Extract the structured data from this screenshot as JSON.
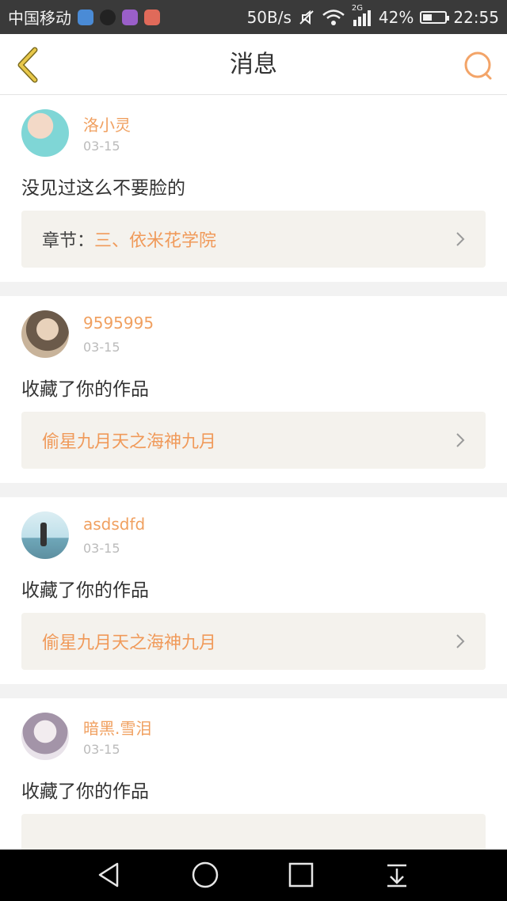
{
  "status_bar": {
    "carrier": "中国移动",
    "speed": "50B/s",
    "network": "2G",
    "battery": "42%",
    "battery_level": 0.42,
    "time": "22:55"
  },
  "header": {
    "title": "消息"
  },
  "messages": [
    {
      "username": "洛小灵",
      "date": "03-15",
      "text": "没见过这么不要脸的",
      "ref_prefix": "章节：",
      "ref_title": "三、依米花学院",
      "avatar_colors": [
        "#7fd6d6",
        "#f3d9c7"
      ]
    },
    {
      "username": "9595995",
      "date": "03-15",
      "text": "收藏了你的作品",
      "ref_prefix": "",
      "ref_title": "偷星九月天之海神九月",
      "avatar_colors": [
        "#c8b39a",
        "#6b5a4a"
      ]
    },
    {
      "username": "asdsdfd",
      "date": "03-15",
      "text": "收藏了你的作品",
      "ref_prefix": "",
      "ref_title": "偷星九月天之海神九月",
      "avatar_colors": [
        "#bfe0ea",
        "#6fa7b9"
      ]
    },
    {
      "username": "暗黑.雪泪",
      "date": "03-15",
      "text": "收藏了你的作品",
      "ref_prefix": "",
      "ref_title": "",
      "avatar_colors": [
        "#e9e3ea",
        "#a394a8"
      ]
    }
  ],
  "colors": {
    "accent": "#f09a5a",
    "back_icon": "#e8c84a",
    "search_icon": "#f3a468"
  }
}
